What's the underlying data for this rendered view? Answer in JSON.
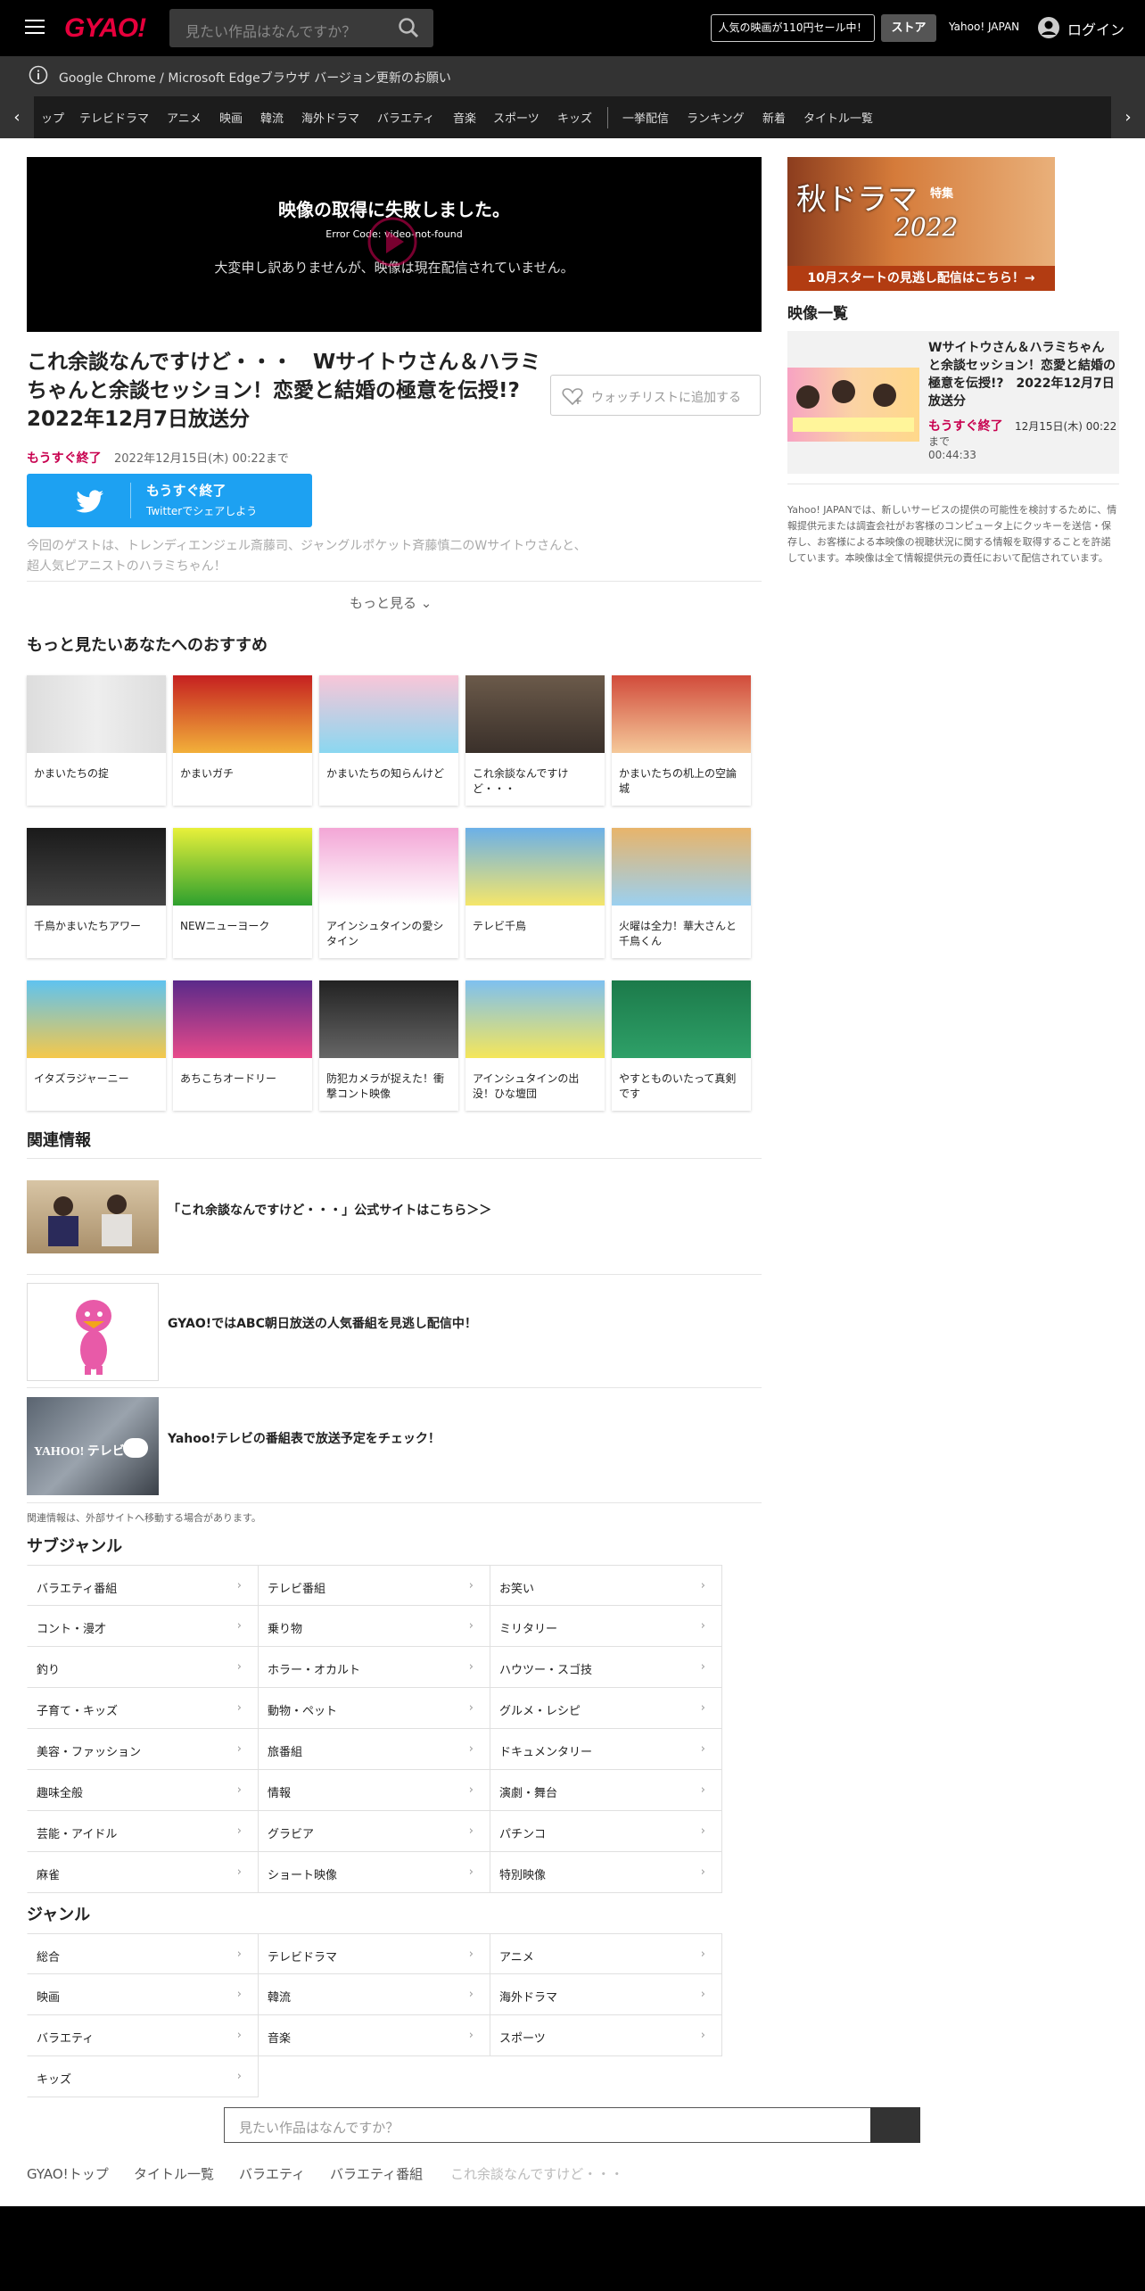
{
  "header": {
    "logo": "GYAO!",
    "search_placeholder": "見たい作品はなんですか？",
    "sale_label": "人気の映画が110円セール中！",
    "store_label": "ストア",
    "yahoo_label": "Yahoo! JAPAN",
    "login_label": "ログイン"
  },
  "notice": {
    "text": "Google Chrome / Microsoft Edgeブラウザ バージョン更新のお願い"
  },
  "nav": {
    "items": [
      "ップ",
      "テレビドラマ",
      "アニメ",
      "映画",
      "韓流",
      "海外ドラマ",
      "バラエティ",
      "音楽",
      "スポーツ",
      "キッズ",
      "一挙配信",
      "ランキング",
      "新着",
      "タイトル一覧"
    ]
  },
  "player": {
    "error_title": "映像の取得に失敗しました。",
    "error_code": "Error Code: video-not-found",
    "error_message": "大変申し訳ありませんが、映像は現在配信されていません。"
  },
  "episode": {
    "title": "これ余談なんですけど・・・　Wサイトウさん＆ハラミちゃんと余談セッション！恋愛と結婚の極意を伝授!?　2022年12月7日放送分",
    "watchlist_label": "ウォッチリストに追加する",
    "ending_label": "もうすぐ終了",
    "date": "2022年12月15日(木) 00:22まで",
    "twitter_label1": "もうすぐ終了",
    "twitter_label2": "Twitterでシェアしよう",
    "description": "今回のゲストは、トレンディエンジェル斎藤司、ジャングルポケット斉藤慎二のWサイトウさんと、超人気ピアニストのハラミちゃん！",
    "more_label": "もっと見る"
  },
  "recommendations": {
    "heading": "もっと見たいあなたへのおすすめ",
    "items": [
      {
        "label": "かまいたちの掟"
      },
      {
        "label": "かまいガチ"
      },
      {
        "label": "かまいたちの知らんけど"
      },
      {
        "label": "これ余談なんですけど・・・"
      },
      {
        "label": "かまいたちの机上の空論城"
      },
      {
        "label": "千鳥かまいたちアワー"
      },
      {
        "label": "NEWニューヨーク"
      },
      {
        "label": "アインシュタインの愛シタイン"
      },
      {
        "label": "テレビ千鳥"
      },
      {
        "label": "火曜は全力！華大さんと千鳥くん"
      },
      {
        "label": "イタズラジャーニー"
      },
      {
        "label": "あちこちオードリー"
      },
      {
        "label": "防犯カメラが捉えた！衝撃コント映像"
      },
      {
        "label": "アインシュタインの出没！ひな壇団"
      },
      {
        "label": "やすとものいたって真剣です"
      }
    ]
  },
  "related": {
    "heading": "関連情報",
    "items": [
      {
        "label": "「これ余談なんですけど・・・」公式サイトはこちら＞＞"
      },
      {
        "label": "GYAO!ではABC朝日放送の人気番組を見逃し配信中！"
      },
      {
        "label": "Yahoo!テレビの番組表で放送予定をチェック！"
      }
    ],
    "note": "関連情報は、外部サイトへ移動する場合があります。",
    "yahoo_tv_logo": "YAHOO! テレビ"
  },
  "subgenre": {
    "heading": "サブジャンル",
    "items": [
      "バラエティ番組",
      "テレビ番組",
      "お笑い",
      "コント・漫才",
      "乗り物",
      "ミリタリー",
      "釣り",
      "ホラー・オカルト",
      "ハウツー・スゴ技",
      "子育て・キッズ",
      "動物・ペット",
      "グルメ・レシピ",
      "美容・ファッション",
      "旅番組",
      "ドキュメンタリー",
      "趣味全般",
      "情報",
      "演劇・舞台",
      "芸能・アイドル",
      "グラビア",
      "パチンコ",
      "麻雀",
      "ショート映像",
      "特別映像"
    ]
  },
  "genre": {
    "heading": "ジャンル",
    "items": [
      "総合",
      "テレビドラマ",
      "アニメ",
      "映画",
      "韓流",
      "海外ドラマ",
      "バラエティ",
      "音楽",
      "スポーツ",
      "キッズ"
    ]
  },
  "bottom_search": {
    "placeholder": "見たい作品はなんですか？"
  },
  "breadcrumb": [
    "GYAO!トップ",
    "タイトル一覧",
    "バラエティ",
    "バラエティ番組",
    "これ余談なんですけど・・・"
  ],
  "sidebar": {
    "banner_title": "秋ドラマ",
    "banner_subtitle": "2022",
    "banner_small": "特集",
    "banner_bar": "10月スタートの見逃し配信はこちら！→",
    "list_heading": "映像一覧",
    "item_title": "Wサイトウさん＆ハラミちゃんと余談セッション！恋愛と結婚の極意を伝授!?　2022年12月7日放送分",
    "item_ending": "もうすぐ終了",
    "item_date": "12月15日(木) 00:22",
    "item_made": "まで",
    "item_duration": "00:44:33",
    "note": "Yahoo! JAPANでは、新しいサービスの提供の可能性を検討するために、情報提供元または調査会社がお客様のコンピュータ上にクッキーを送信・保存し、お客様による本映像の視聴状況に関する情報を取得することを許諾しています。本映像は全て情報提供元の責任において配信されています。"
  },
  "colors": {
    "accent": "#e6003c",
    "ending": "#c8004f",
    "twitter": "#1da1f2"
  }
}
